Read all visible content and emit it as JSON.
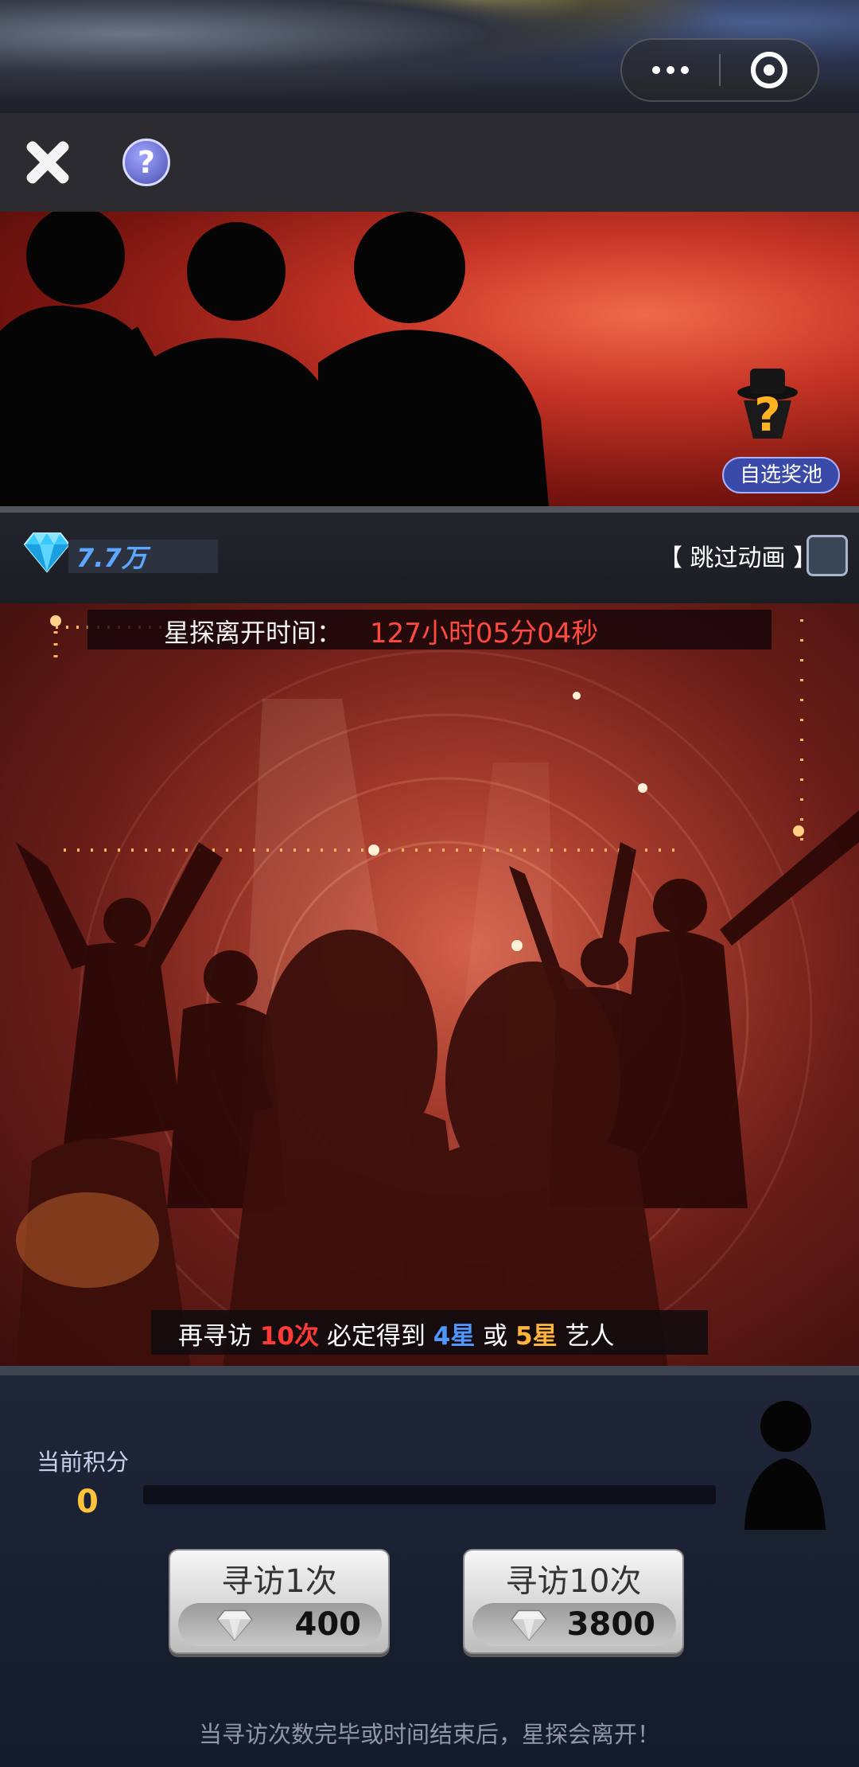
{
  "header": {
    "close_icon": "close-icon",
    "help_icon": "help-icon",
    "help_text": "?"
  },
  "banner": {
    "pool_label": "自选奖池",
    "pool_icon": "mystery-question-icon"
  },
  "currency": {
    "gem_amount": "7.7万",
    "skip_animation_label": "【 跳过动画 】",
    "skip_animation_checked": false
  },
  "timer": {
    "label": "星探离开时间：",
    "value": "127小时05分04秒"
  },
  "guarantee": {
    "prefix": "再寻访 ",
    "count": "10次",
    "mid": " 必定得到 ",
    "star4": "4星",
    "or": " 或 ",
    "star5": "5星",
    "suffix": "  艺人"
  },
  "points": {
    "label": "当前积分",
    "value": "0",
    "progress": 0
  },
  "actions": {
    "single": {
      "label": "寻访1次",
      "cost": "400"
    },
    "ten": {
      "label": "寻访10次",
      "cost": "3800"
    }
  },
  "footer": {
    "note": "当寻访次数完毕或时间结束后，星探会离开！"
  },
  "colors": {
    "gem_blue": "#5ca7ff",
    "timer_red": "#ff4a40",
    "points_gold": "#ffc23d",
    "star4_blue": "#4f96ff",
    "star5_gold": "#ffb43a"
  }
}
